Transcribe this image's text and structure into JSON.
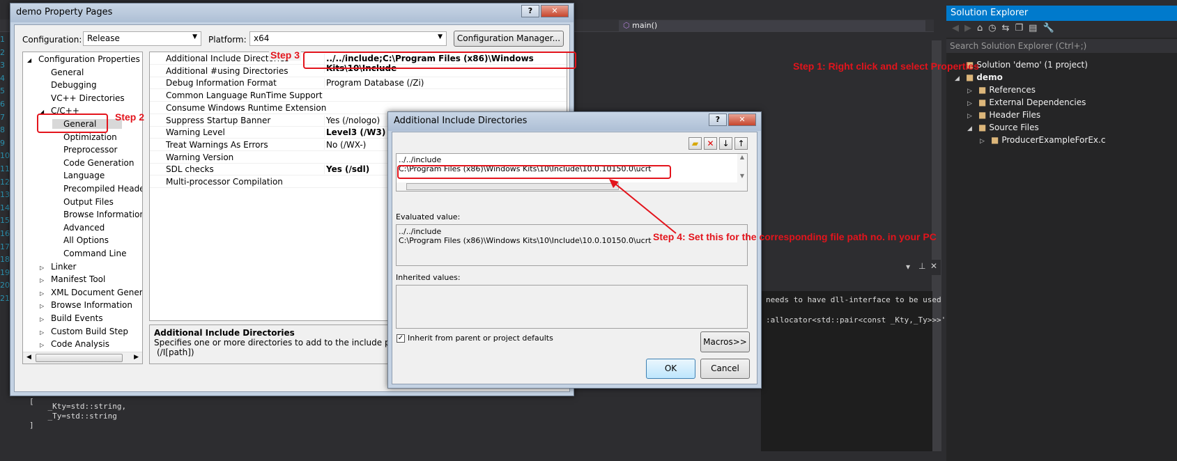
{
  "editor": {
    "nav_function": "main()",
    "line_numbers": [
      "1",
      "2",
      "3",
      "4",
      "5",
      "6",
      "7",
      "8",
      "9",
      "10",
      "11",
      "12",
      "13",
      "14",
      "15",
      "16",
      "17",
      "18",
      "19",
      "20",
      "21"
    ],
    "output_lines": [
      "needs to have dll-interface to be used by",
      ":allocator<std::pair<const _Kty,_Ty>>>' nee"
    ],
    "code_lines": [
      "[",
      "    _Kty=std::string,",
      "    _Ty=std::string",
      "]"
    ]
  },
  "property_pages": {
    "title": "demo Property Pages",
    "help_label": "?",
    "close_label": "✕",
    "configuration_label": "Configuration:",
    "configuration_value": "Release",
    "platform_label": "Platform:",
    "platform_value": "x64",
    "config_manager_label": "Configuration Manager...",
    "tree": [
      {
        "label": "Configuration Properties",
        "expander": "◢",
        "level": 0
      },
      {
        "label": "General",
        "expander": "",
        "level": 1
      },
      {
        "label": "Debugging",
        "expander": "",
        "level": 1
      },
      {
        "label": "VC++ Directories",
        "expander": "",
        "level": 1
      },
      {
        "label": "C/C++",
        "expander": "◢",
        "level": 1
      },
      {
        "label": "General",
        "expander": "",
        "level": 2,
        "selected": true
      },
      {
        "label": "Optimization",
        "expander": "",
        "level": 2
      },
      {
        "label": "Preprocessor",
        "expander": "",
        "level": 2
      },
      {
        "label": "Code Generation",
        "expander": "",
        "level": 2
      },
      {
        "label": "Language",
        "expander": "",
        "level": 2
      },
      {
        "label": "Precompiled Header",
        "expander": "",
        "level": 2
      },
      {
        "label": "Output Files",
        "expander": "",
        "level": 2
      },
      {
        "label": "Browse Information",
        "expander": "",
        "level": 2
      },
      {
        "label": "Advanced",
        "expander": "",
        "level": 2
      },
      {
        "label": "All Options",
        "expander": "",
        "level": 2
      },
      {
        "label": "Command Line",
        "expander": "",
        "level": 2
      },
      {
        "label": "Linker",
        "expander": "▷",
        "level": 1
      },
      {
        "label": "Manifest Tool",
        "expander": "▷",
        "level": 1
      },
      {
        "label": "XML Document Generat",
        "expander": "▷",
        "level": 1
      },
      {
        "label": "Browse Information",
        "expander": "▷",
        "level": 1
      },
      {
        "label": "Build Events",
        "expander": "▷",
        "level": 1
      },
      {
        "label": "Custom Build Step",
        "expander": "▷",
        "level": 1
      },
      {
        "label": "Code Analysis",
        "expander": "▷",
        "level": 1
      }
    ],
    "grid": [
      {
        "name": "Additional Include Directories",
        "value": "../../include;C:\\Program Files (x86)\\Windows Kits\\10\\Include",
        "bold": true
      },
      {
        "name": "Additional #using Directories",
        "value": ""
      },
      {
        "name": "Debug Information Format",
        "value": "Program Database (/Zi)"
      },
      {
        "name": "Common Language RunTime Support",
        "value": ""
      },
      {
        "name": "Consume Windows Runtime Extension",
        "value": ""
      },
      {
        "name": "Suppress Startup Banner",
        "value": "Yes (/nologo)"
      },
      {
        "name": "Warning Level",
        "value": "Level3 (/W3)",
        "bold": true
      },
      {
        "name": "Treat Warnings As Errors",
        "value": "No (/WX-)"
      },
      {
        "name": "Warning Version",
        "value": ""
      },
      {
        "name": "SDL checks",
        "value": "Yes (/sdl)",
        "bold": true
      },
      {
        "name": "Multi-processor Compilation",
        "value": ""
      }
    ],
    "description_title": "Additional Include Directories",
    "description_text": "Specifies one or more directories to add to the include path; se",
    "description_switch": "(/I[path])"
  },
  "include_dialog": {
    "title": "Additional Include Directories",
    "help_label": "?",
    "close_label": "✕",
    "entries": [
      "../../include",
      "C:\\Program Files (x86)\\Windows Kits\\10\\Include\\10.0.10150.0\\ucrt"
    ],
    "evaluated_label": "Evaluated value:",
    "evaluated_lines": [
      "../../include",
      "C:\\Program Files (x86)\\Windows Kits\\10\\Include\\10.0.10150.0\\ucrt"
    ],
    "inherited_label": "Inherited values:",
    "inherit_checkbox_label": "Inherit from parent or project defaults",
    "inherit_checked": true,
    "macros_label": "Macros>>",
    "ok_label": "OK",
    "cancel_label": "Cancel"
  },
  "solution_explorer": {
    "title": "Solution Explorer",
    "search_placeholder": "Search Solution Explorer (Ctrl+;)",
    "items": [
      {
        "label": "Solution 'demo' (1 project)",
        "level": 0,
        "expander": ""
      },
      {
        "label": "demo",
        "level": 0,
        "expander": "◢",
        "bold": true
      },
      {
        "label": "References",
        "level": 1,
        "expander": "▷"
      },
      {
        "label": "External Dependencies",
        "level": 1,
        "expander": "▷"
      },
      {
        "label": "Header Files",
        "level": 1,
        "expander": "▷"
      },
      {
        "label": "Source Files",
        "level": 1,
        "expander": "◢"
      },
      {
        "label": "ProducerExampleForEx.c",
        "level": 2,
        "expander": "▷"
      }
    ]
  },
  "annotations": {
    "step1": "Step 1: Right click and select Properties",
    "step2": "Step 2",
    "step3": "Step 3",
    "step4": "Step 4: Set this for the corresponding file path no. in your PC",
    "color": "#e3141c"
  }
}
